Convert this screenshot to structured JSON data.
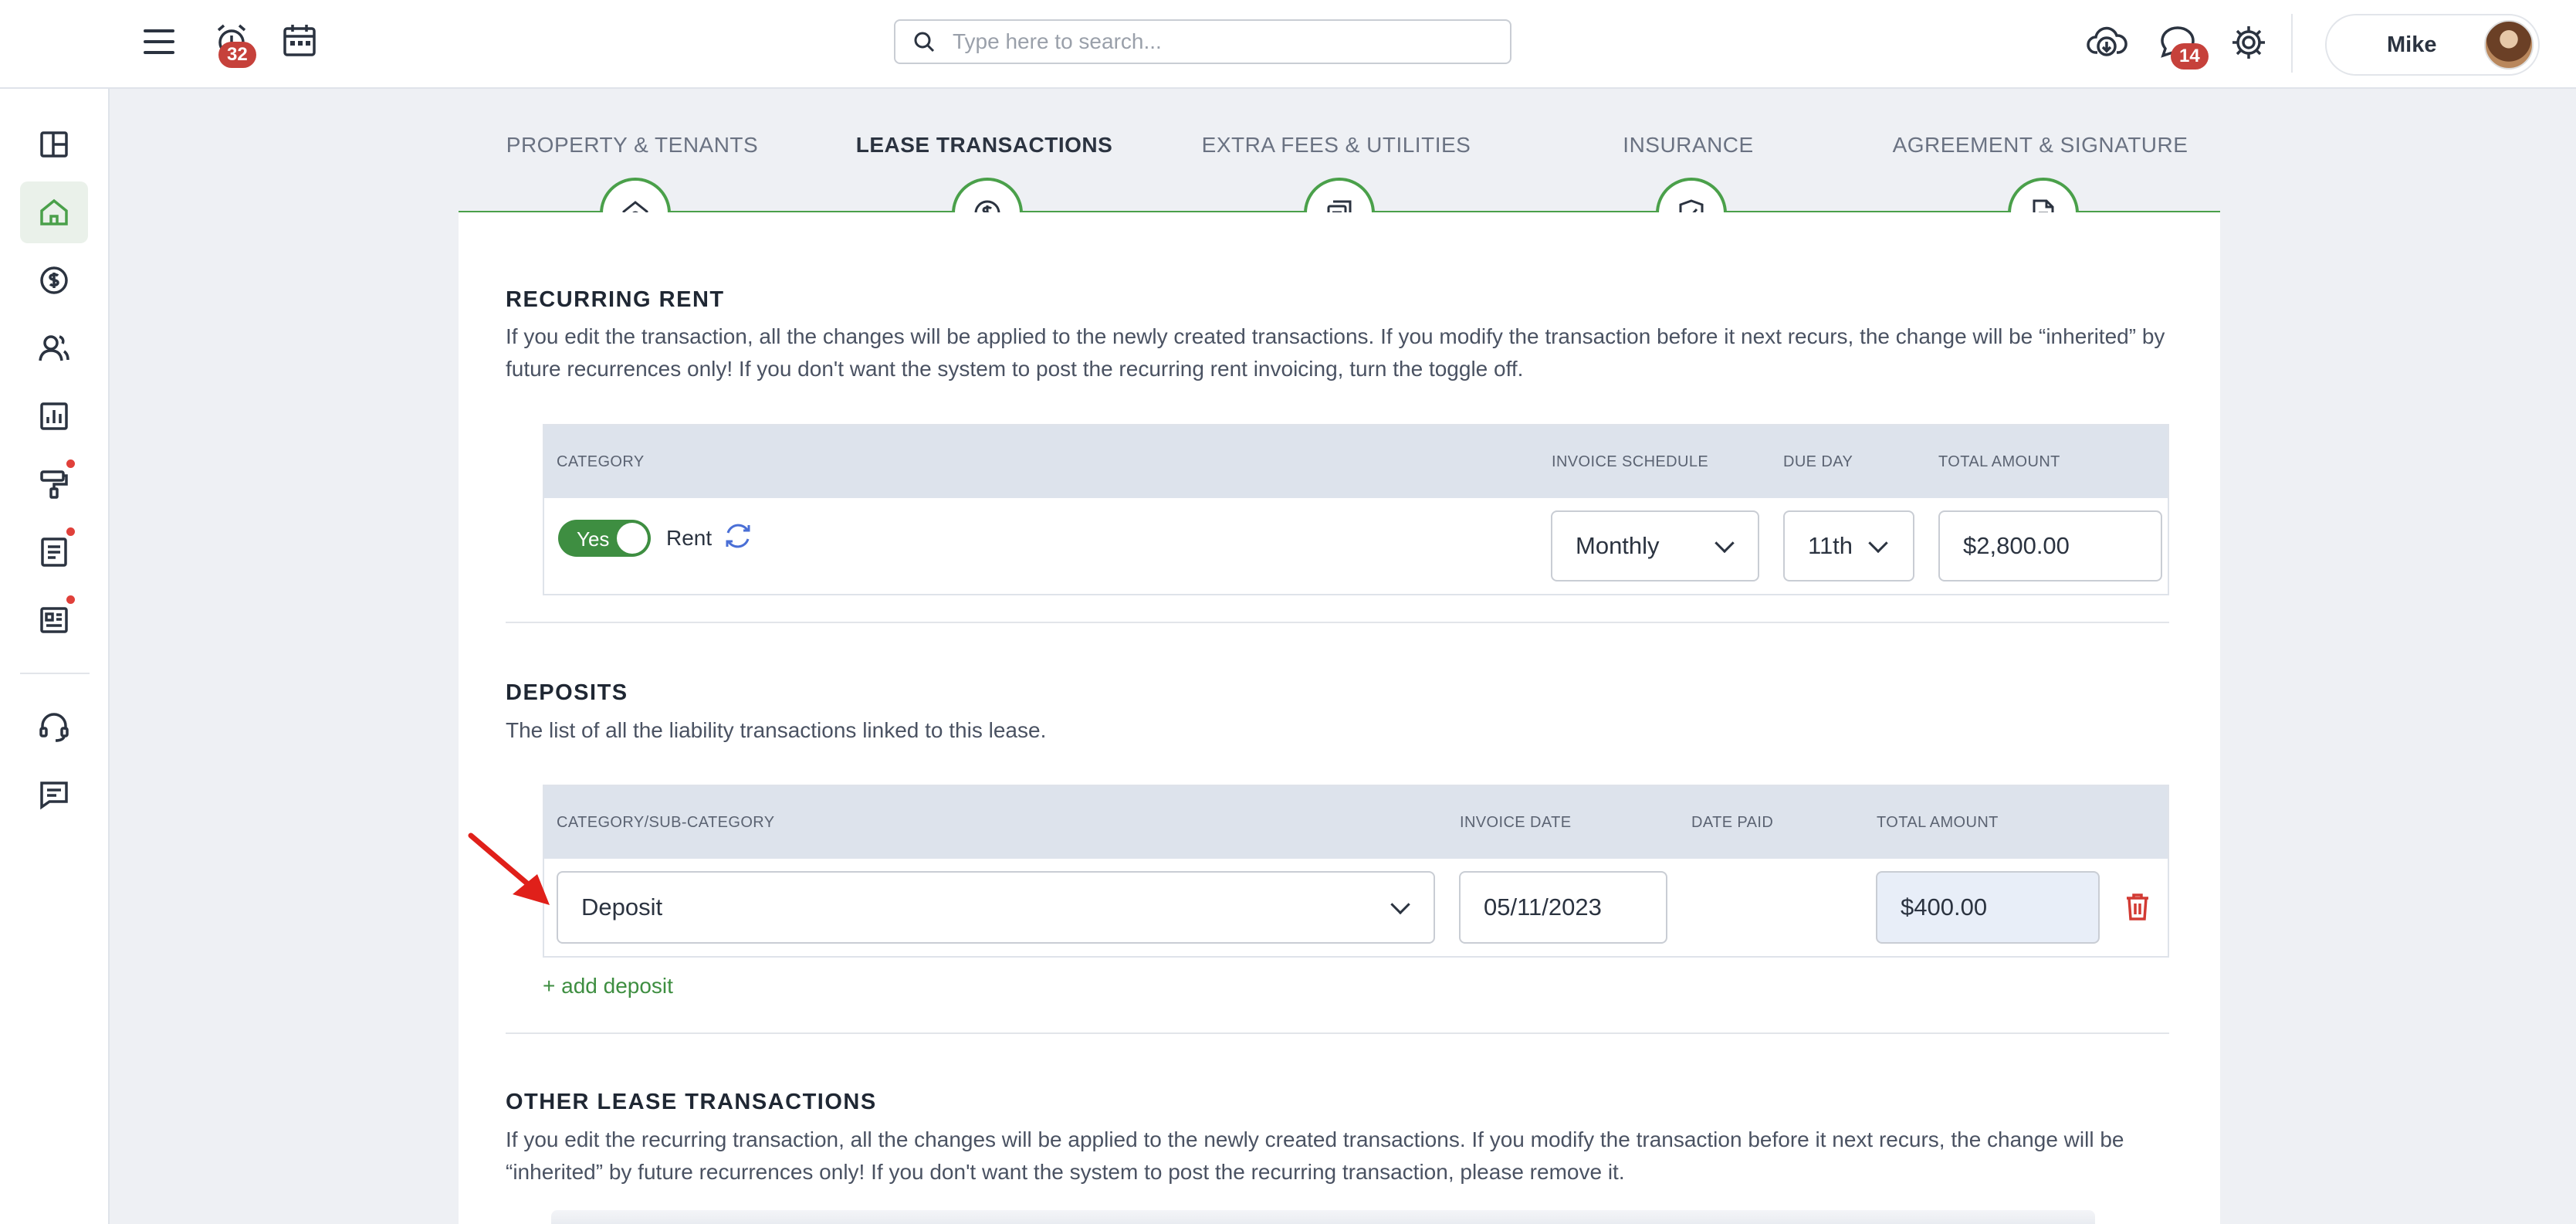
{
  "header": {
    "search_placeholder": "Type here to search...",
    "alarm_badge": "32",
    "chat_badge": "14",
    "user_name": "Mike"
  },
  "sidebar": {
    "items": [
      {
        "icon": "dashboard-icon"
      },
      {
        "icon": "home-icon",
        "active": true
      },
      {
        "icon": "dollar-icon"
      },
      {
        "icon": "people-icon"
      },
      {
        "icon": "chart-icon"
      },
      {
        "icon": "paint-roller-icon",
        "alert": true
      },
      {
        "icon": "document-icon",
        "alert": true
      },
      {
        "icon": "newspaper-icon",
        "alert": true
      },
      {
        "icon": "headset-icon"
      },
      {
        "icon": "message-icon"
      }
    ]
  },
  "steps": [
    {
      "label": "PROPERTY & TENANTS",
      "icon": "house-icon"
    },
    {
      "label": "LEASE TRANSACTIONS",
      "icon": "dollar-circle-icon",
      "active": true
    },
    {
      "label": "EXTRA FEES & UTILITIES",
      "icon": "receipt-icon"
    },
    {
      "label": "INSURANCE",
      "icon": "shield-check-icon"
    },
    {
      "label": "AGREEMENT & SIGNATURE",
      "icon": "document-icon"
    }
  ],
  "recurring_rent": {
    "title": "RECURRING RENT",
    "description": "If you edit the transaction, all the changes will be applied to the newly created transactions. If you modify the transaction before it next recurs, the change will be “inherited” by future recurrences only! If you don't want the system to post the recurring rent invoicing, turn the toggle off.",
    "columns": {
      "category": "CATEGORY",
      "invoice_schedule": "INVOICE SCHEDULE",
      "due_day": "DUE DAY",
      "total_amount": "TOTAL AMOUNT"
    },
    "row": {
      "toggle_label": "Yes",
      "category": "Rent",
      "schedule": "Monthly",
      "due_day": "11th",
      "amount": "$2,800.00"
    }
  },
  "deposits": {
    "title": "DEPOSITS",
    "description": "The list of all the liability transactions linked to this lease.",
    "columns": {
      "category": "CATEGORY/SUB-CATEGORY",
      "invoice_date": "INVOICE DATE",
      "date_paid": "DATE PAID",
      "total_amount": "TOTAL AMOUNT"
    },
    "row": {
      "category": "Deposit",
      "invoice_date": "05/11/2023",
      "date_paid": "",
      "amount": "$400.00"
    },
    "add_label": "+ add deposit"
  },
  "other": {
    "title": "OTHER LEASE TRANSACTIONS",
    "description": "If you edit the recurring transaction, all the changes will be applied to the newly created transactions. If you modify the transaction before it next recurs, the change will be “inherited” by future recurrences only! If you don't want the system to post the recurring transaction, please remove it."
  },
  "colors": {
    "accent": "#4aa04a",
    "badge": "#c6413b",
    "arrow": "#e0201a",
    "header_bg": "#dde3ec"
  }
}
